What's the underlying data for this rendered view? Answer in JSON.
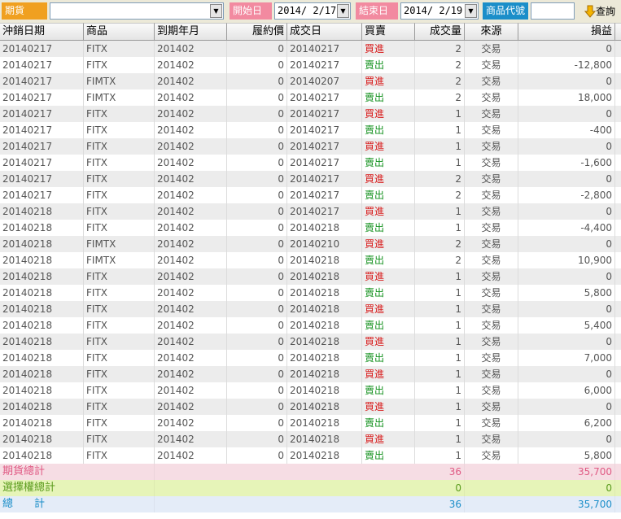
{
  "toolbar": {
    "market_label": "期貨",
    "market_value": "",
    "start_label": "開始日",
    "start_value": "2014/ 2/17",
    "end_label": "結束日",
    "end_value": "2014/ 2/19",
    "product_code_label": "商品代號",
    "product_code_value": "",
    "query_label": "查詢",
    "colors": {
      "market_label_bg": "#f0a020",
      "start_label_bg": "#f28aa0",
      "end_label_bg": "#f28aa0",
      "product_label_bg": "#1b8ec9"
    }
  },
  "grid": {
    "headers": [
      "沖銷日期",
      "商品",
      "到期年月",
      "履約價",
      "成交日",
      "買賣",
      "成交量",
      "來源",
      "損益"
    ],
    "rows": [
      {
        "close_date": "20140217",
        "product": "FITX",
        "expiry": "201402",
        "strike": "0",
        "trade_date": "20140217",
        "side": "買進",
        "side_type": "buy",
        "qty": "2",
        "source": "交易",
        "pnl": "0"
      },
      {
        "close_date": "20140217",
        "product": "FITX",
        "expiry": "201402",
        "strike": "0",
        "trade_date": "20140217",
        "side": "賣出",
        "side_type": "sell",
        "qty": "2",
        "source": "交易",
        "pnl": "-12,800"
      },
      {
        "close_date": "20140217",
        "product": "FIMTX",
        "expiry": "201402",
        "strike": "0",
        "trade_date": "20140207",
        "side": "買進",
        "side_type": "buy",
        "qty": "2",
        "source": "交易",
        "pnl": "0"
      },
      {
        "close_date": "20140217",
        "product": "FIMTX",
        "expiry": "201402",
        "strike": "0",
        "trade_date": "20140217",
        "side": "賣出",
        "side_type": "sell",
        "qty": "2",
        "source": "交易",
        "pnl": "18,000"
      },
      {
        "close_date": "20140217",
        "product": "FITX",
        "expiry": "201402",
        "strike": "0",
        "trade_date": "20140217",
        "side": "買進",
        "side_type": "buy",
        "qty": "1",
        "source": "交易",
        "pnl": "0"
      },
      {
        "close_date": "20140217",
        "product": "FITX",
        "expiry": "201402",
        "strike": "0",
        "trade_date": "20140217",
        "side": "賣出",
        "side_type": "sell",
        "qty": "1",
        "source": "交易",
        "pnl": "-400"
      },
      {
        "close_date": "20140217",
        "product": "FITX",
        "expiry": "201402",
        "strike": "0",
        "trade_date": "20140217",
        "side": "買進",
        "side_type": "buy",
        "qty": "1",
        "source": "交易",
        "pnl": "0"
      },
      {
        "close_date": "20140217",
        "product": "FITX",
        "expiry": "201402",
        "strike": "0",
        "trade_date": "20140217",
        "side": "賣出",
        "side_type": "sell",
        "qty": "1",
        "source": "交易",
        "pnl": "-1,600"
      },
      {
        "close_date": "20140217",
        "product": "FITX",
        "expiry": "201402",
        "strike": "0",
        "trade_date": "20140217",
        "side": "買進",
        "side_type": "buy",
        "qty": "2",
        "source": "交易",
        "pnl": "0"
      },
      {
        "close_date": "20140217",
        "product": "FITX",
        "expiry": "201402",
        "strike": "0",
        "trade_date": "20140217",
        "side": "賣出",
        "side_type": "sell",
        "qty": "2",
        "source": "交易",
        "pnl": "-2,800"
      },
      {
        "close_date": "20140218",
        "product": "FITX",
        "expiry": "201402",
        "strike": "0",
        "trade_date": "20140217",
        "side": "買進",
        "side_type": "buy",
        "qty": "1",
        "source": "交易",
        "pnl": "0"
      },
      {
        "close_date": "20140218",
        "product": "FITX",
        "expiry": "201402",
        "strike": "0",
        "trade_date": "20140218",
        "side": "賣出",
        "side_type": "sell",
        "qty": "1",
        "source": "交易",
        "pnl": "-4,400"
      },
      {
        "close_date": "20140218",
        "product": "FIMTX",
        "expiry": "201402",
        "strike": "0",
        "trade_date": "20140210",
        "side": "買進",
        "side_type": "buy",
        "qty": "2",
        "source": "交易",
        "pnl": "0"
      },
      {
        "close_date": "20140218",
        "product": "FIMTX",
        "expiry": "201402",
        "strike": "0",
        "trade_date": "20140218",
        "side": "賣出",
        "side_type": "sell",
        "qty": "2",
        "source": "交易",
        "pnl": "10,900"
      },
      {
        "close_date": "20140218",
        "product": "FITX",
        "expiry": "201402",
        "strike": "0",
        "trade_date": "20140218",
        "side": "買進",
        "side_type": "buy",
        "qty": "1",
        "source": "交易",
        "pnl": "0"
      },
      {
        "close_date": "20140218",
        "product": "FITX",
        "expiry": "201402",
        "strike": "0",
        "trade_date": "20140218",
        "side": "賣出",
        "side_type": "sell",
        "qty": "1",
        "source": "交易",
        "pnl": "5,800"
      },
      {
        "close_date": "20140218",
        "product": "FITX",
        "expiry": "201402",
        "strike": "0",
        "trade_date": "20140218",
        "side": "買進",
        "side_type": "buy",
        "qty": "1",
        "source": "交易",
        "pnl": "0"
      },
      {
        "close_date": "20140218",
        "product": "FITX",
        "expiry": "201402",
        "strike": "0",
        "trade_date": "20140218",
        "side": "賣出",
        "side_type": "sell",
        "qty": "1",
        "source": "交易",
        "pnl": "5,400"
      },
      {
        "close_date": "20140218",
        "product": "FITX",
        "expiry": "201402",
        "strike": "0",
        "trade_date": "20140218",
        "side": "買進",
        "side_type": "buy",
        "qty": "1",
        "source": "交易",
        "pnl": "0"
      },
      {
        "close_date": "20140218",
        "product": "FITX",
        "expiry": "201402",
        "strike": "0",
        "trade_date": "20140218",
        "side": "賣出",
        "side_type": "sell",
        "qty": "1",
        "source": "交易",
        "pnl": "7,000"
      },
      {
        "close_date": "20140218",
        "product": "FITX",
        "expiry": "201402",
        "strike": "0",
        "trade_date": "20140218",
        "side": "買進",
        "side_type": "buy",
        "qty": "1",
        "source": "交易",
        "pnl": "0"
      },
      {
        "close_date": "20140218",
        "product": "FITX",
        "expiry": "201402",
        "strike": "0",
        "trade_date": "20140218",
        "side": "賣出",
        "side_type": "sell",
        "qty": "1",
        "source": "交易",
        "pnl": "6,000"
      },
      {
        "close_date": "20140218",
        "product": "FITX",
        "expiry": "201402",
        "strike": "0",
        "trade_date": "20140218",
        "side": "買進",
        "side_type": "buy",
        "qty": "1",
        "source": "交易",
        "pnl": "0"
      },
      {
        "close_date": "20140218",
        "product": "FITX",
        "expiry": "201402",
        "strike": "0",
        "trade_date": "20140218",
        "side": "賣出",
        "side_type": "sell",
        "qty": "1",
        "source": "交易",
        "pnl": "6,200"
      },
      {
        "close_date": "20140218",
        "product": "FITX",
        "expiry": "201402",
        "strike": "0",
        "trade_date": "20140218",
        "side": "買進",
        "side_type": "buy",
        "qty": "1",
        "source": "交易",
        "pnl": "0"
      },
      {
        "close_date": "20140218",
        "product": "FITX",
        "expiry": "201402",
        "strike": "0",
        "trade_date": "20140218",
        "side": "賣出",
        "side_type": "sell",
        "qty": "1",
        "source": "交易",
        "pnl": "5,800"
      }
    ],
    "side_colors": {
      "buy": "#d81b1b",
      "sell": "#13911e"
    }
  },
  "summary": {
    "futures": {
      "label": "期貨總計",
      "qty": "36",
      "pnl": "35,700",
      "color": "#e05a84"
    },
    "options": {
      "label": "選擇權總計",
      "qty": "0",
      "pnl": "0",
      "color": "#5a9b1c"
    },
    "total": {
      "label": "總　　計",
      "qty": "36",
      "pnl": "35,700",
      "color": "#1b8ec9"
    }
  }
}
